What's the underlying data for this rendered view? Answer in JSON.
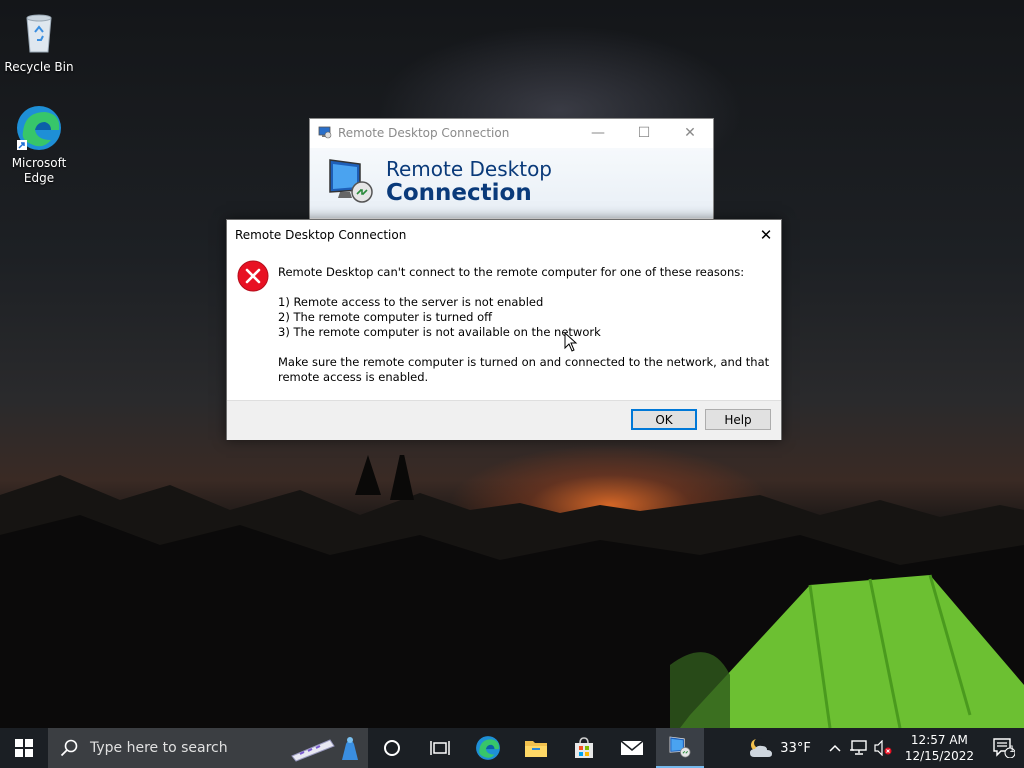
{
  "desktop": {
    "icons": [
      {
        "label": "Recycle Bin",
        "icon": "recycle-bin-icon"
      },
      {
        "label": "Microsoft Edge",
        "icon": "edge-icon"
      }
    ]
  },
  "background_window": {
    "title": "Remote Desktop Connection",
    "banner_line1": "Remote Desktop",
    "banner_line2": "Connection",
    "controls": {
      "minimize": "—",
      "maximize": "☐",
      "close": "✕"
    }
  },
  "dialog": {
    "title": "Remote Desktop Connection",
    "close_glyph": "✕",
    "icon": "error-icon",
    "message": "Remote Desktop can't connect to the remote computer for one of these reasons:",
    "reasons": [
      "1) Remote access to the server is not enabled",
      "2) The remote computer is turned off",
      "3) The remote computer is not available on the network"
    ],
    "advice": "Make sure the remote computer is turned on and connected to the network, and that remote access is enabled.",
    "buttons": {
      "ok": "OK",
      "help": "Help"
    }
  },
  "taskbar": {
    "search_placeholder": "Type here to search",
    "weather_temp": "33°F",
    "clock_time": "12:57 AM",
    "clock_date": "12/15/2022",
    "notification_count": "1"
  },
  "colors": {
    "accent": "#0078d7",
    "error_red": "#e81123",
    "banner_blue": "#0a3a7a",
    "taskbar": "#1b1f24"
  }
}
